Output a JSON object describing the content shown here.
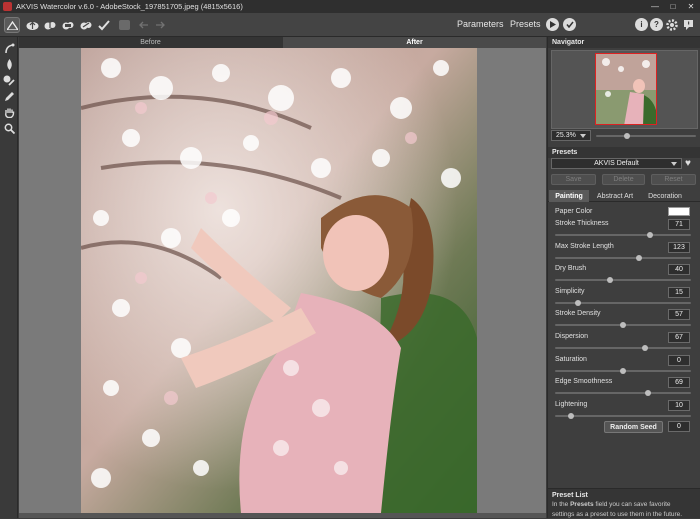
{
  "window": {
    "title": "AKVIS Watercolor v.6.0 - AdobeStock_197851705.jpeg (4815x5616)"
  },
  "toolbar": {
    "parameters_label": "Parameters",
    "presets_label": "Presets",
    "info_icon": "i",
    "help_icon": "?"
  },
  "view_tabs": {
    "before": "Before",
    "after": "After",
    "active": "After"
  },
  "navigator": {
    "title": "Navigator",
    "zoom": "25.3%",
    "zoom_level": 0.3
  },
  "presets": {
    "title": "Presets",
    "selected": "AKVIS Default",
    "save": "Save",
    "delete": "Delete",
    "reset": "Reset"
  },
  "param_tabs": {
    "painting": "Painting",
    "abstract_art": "Abstract Art",
    "decoration": "Decoration",
    "active": "Painting"
  },
  "params": {
    "paper_color_label": "Paper Color",
    "paper_color": "#ffffff",
    "items": [
      {
        "label": "Stroke Thickness",
        "value": "71",
        "level": 0.71
      },
      {
        "label": "Max Stroke Length",
        "value": "123",
        "level": 0.62
      },
      {
        "label": "Dry Brush",
        "value": "40",
        "level": 0.4
      },
      {
        "label": "Simplicity",
        "value": "15",
        "level": 0.15
      },
      {
        "label": "Stroke Density",
        "value": "57",
        "level": 0.5
      },
      {
        "label": "Dispersion",
        "value": "67",
        "level": 0.67
      },
      {
        "label": "Saturation",
        "value": "0",
        "level": 0.5
      },
      {
        "label": "Edge Smoothness",
        "value": "69",
        "level": 0.69
      },
      {
        "label": "Lightening",
        "value": "10",
        "level": 0.1
      }
    ],
    "random_seed_label": "Random Seed",
    "random_seed": "0"
  },
  "preset_list": {
    "title": "Preset List",
    "text_pre": "In the ",
    "text_bold": "Presets",
    "text_post": " field you can save favorite",
    "text_line2": "settings as a preset to use them in the future."
  }
}
